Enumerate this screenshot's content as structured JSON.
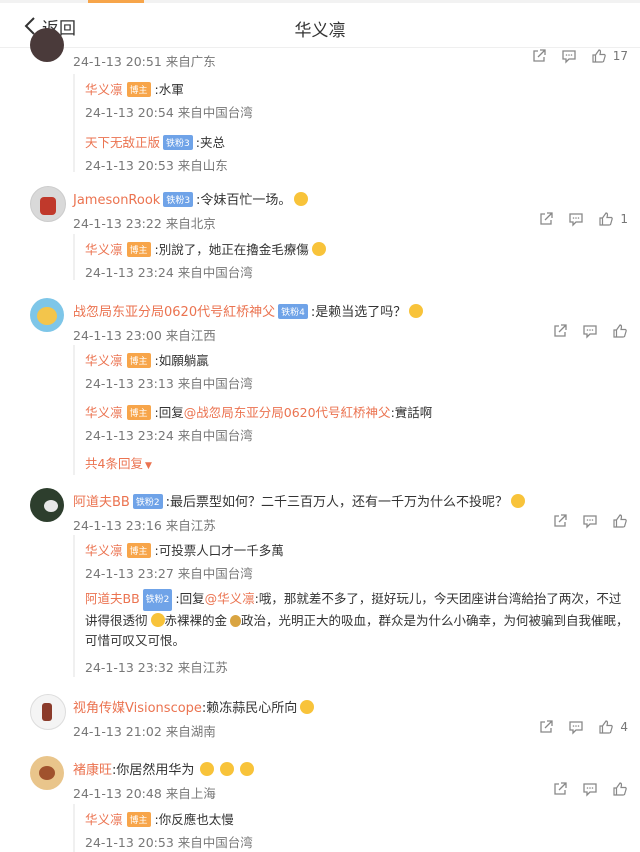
{
  "header": {
    "back_label": "返回",
    "title": "华义凛"
  },
  "host_badge": "博主",
  "comments": [
    {
      "meta": "24-1-13 20:51 来自广东",
      "likes": "17",
      "replies": [
        {
          "name": "华义凛",
          "text": ":水軍",
          "meta": "24-1-13 20:54 来自中国台湾"
        },
        {
          "name": "天下无敌正版",
          "level": "铁粉3",
          "text": ":夹总",
          "meta": "24-1-13 20:53 来自山东"
        }
      ]
    },
    {
      "name": "JamesonRook",
      "level": "铁粉3",
      "text": ":令妹百忙一场。",
      "meta": "24-1-13 23:22 来自北京",
      "likes": "1",
      "replies": [
        {
          "name": "华义凛",
          "text": ":別說了，她正在擼金毛療傷",
          "meta": "24-1-13 23:24 来自中国台湾"
        }
      ]
    },
    {
      "name": "战忽局东亚分局0620代号紅桥神父",
      "level": "铁粉4",
      "text": ":是赖当选了吗？",
      "meta": "24-1-13 23:00 来自江西",
      "replies": [
        {
          "name": "华义凛",
          "text": ":如願躺贏",
          "meta": "24-1-13 23:13 来自中国台湾"
        },
        {
          "name": "华义凛",
          "text": ":回复",
          "mention": "@战忽局东亚分局0620代号紅桥神父",
          "text2": ":實話啊",
          "meta": "24-1-13 23:24 来自中国台湾"
        }
      ],
      "more": "共4条回复"
    },
    {
      "name": "阿道夫BB",
      "level": "铁粉2",
      "text": ":最后票型如何？二千三百万人，还有一千万为什么不投呢？",
      "meta": "24-1-13 23:16 来自江苏",
      "replies": [
        {
          "name": "华义凛",
          "text": ":可投票人口才一千多萬",
          "meta": "24-1-13 23:27 来自中国台湾"
        },
        {
          "name": "阿道夫BB",
          "level": "铁粉2",
          "text": ":回复",
          "mention": "@华义凛",
          "text2": ":哦，那就差不多了，挺好玩儿，今天团座讲台湾給抬了两次，不过讲得很透彻",
          "text3": "赤裸裸的金",
          "text4": "政治，光明正大的吸血，群众是为什么小确幸，为何被骗到自我催眠，可惜可叹又可恨。",
          "meta": "24-1-13 23:32 来自江苏"
        }
      ]
    },
    {
      "name": "视角传媒Visionscope",
      "text": ":赖冻蒜民心所向",
      "meta": "24-1-13 21:02 来自湖南",
      "likes": "4"
    },
    {
      "name": "褚康旺",
      "text": ":你居然用华为",
      "meta": "24-1-13 20:48 来自上海",
      "replies": [
        {
          "name": "华义凛",
          "text": ":你反應也太慢",
          "meta": "24-1-13 20:53 来自中国台湾"
        }
      ]
    }
  ],
  "colors": {
    "accent": "#eb7350",
    "host_badge": "#f7a54a",
    "level_badge": "#6fa3e8",
    "meta": "#777777"
  }
}
